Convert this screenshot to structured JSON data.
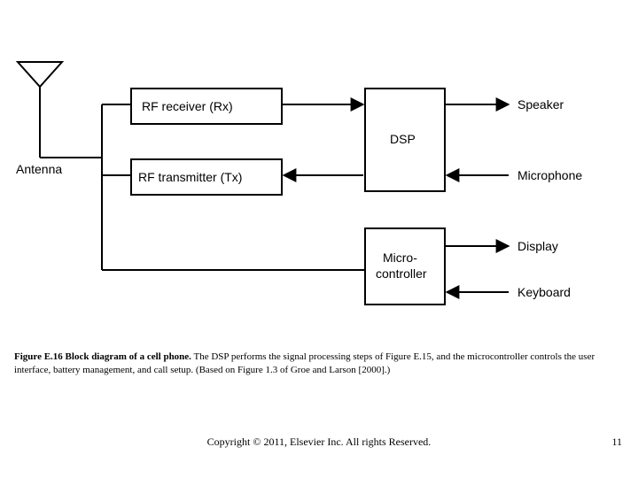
{
  "diagram": {
    "antenna_label": "Antenna",
    "rx_label": "RF receiver (Rx)",
    "tx_label": "RF transmitter (Tx)",
    "dsp_label": "DSP",
    "micro_label_line1": "Micro-",
    "micro_label_line2": "controller",
    "speaker_label": "Speaker",
    "microphone_label": "Microphone",
    "display_label": "Display",
    "keyboard_label": "Keyboard"
  },
  "caption": {
    "lead": "Figure E.16 Block diagram of a cell phone.",
    "body": " The DSP performs the signal processing steps of Figure E.15, and the microcontroller controls the user interface, battery management, and call setup. (Based on Figure 1.3 of Groe and Larson [2000].)"
  },
  "footer": {
    "copyright": "Copyright © 2011, Elsevier Inc. All rights Reserved.",
    "page": "11"
  }
}
